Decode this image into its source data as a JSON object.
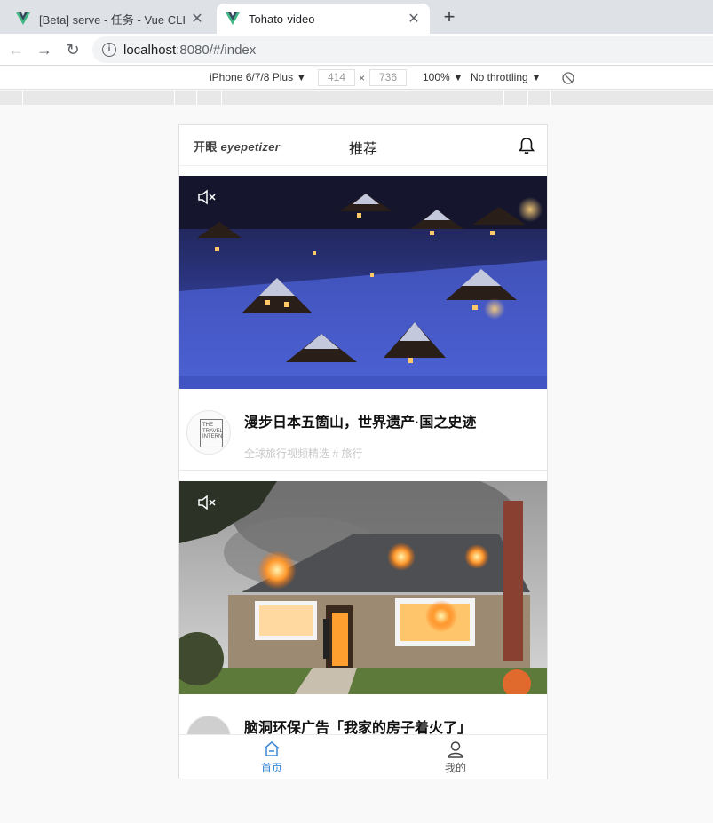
{
  "browser": {
    "tabs": [
      {
        "title": "[Beta] serve - 任务 - Vue CLI",
        "active": false
      },
      {
        "title": "Tohato-video",
        "active": true
      }
    ],
    "new_tab_label": "+",
    "close_label": "✕",
    "address": {
      "host": "localhost",
      "rest": ":8080/#/index"
    }
  },
  "devtools": {
    "device": "iPhone 6/7/8 Plus ▼",
    "width": "414",
    "height": "736",
    "times": "×",
    "zoom": "100% ▼",
    "throttling": "No throttling ▼"
  },
  "app": {
    "header": {
      "logo_cn": "开眼",
      "logo_en": " eyepetizer",
      "title": "推荐"
    },
    "cards": [
      {
        "title": "漫步日本五箇山，世界遗产·国之史迹",
        "meta": "全球旅行视频精选 # 旅行",
        "avatar_text": "THE TRAVEL INTERN"
      },
      {
        "title": "脑洞环保广告「我家的房子着火了」",
        "meta": ""
      }
    ],
    "bottom_nav": [
      {
        "label": "首页",
        "active": true,
        "icon": "home-icon"
      },
      {
        "label": "我的",
        "active": false,
        "icon": "user-icon"
      }
    ]
  },
  "colors": {
    "accent": "#3b87d3",
    "tab_strip": "#dee1e6"
  }
}
